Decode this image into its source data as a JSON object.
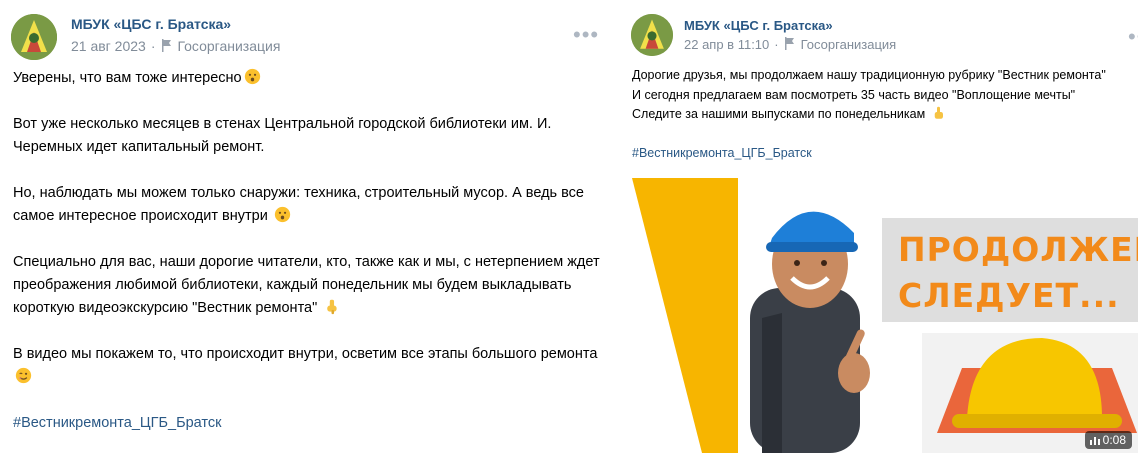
{
  "posts": [
    {
      "author": "МБУК «ЦБС г. Братска»",
      "date": "21 авг 2023",
      "category": "Госорганизация",
      "paragraphs": [
        "Уверены, что вам тоже интересно",
        "Вот уже несколько месяцев в стенах Центральной городской библиотеки им. И. Черемных идет капитальный ремонт.",
        "Но, наблюдать мы можем только снаружи: техника, строительный мусор. А ведь все самое интересное происходит внутри",
        "Специально для вас, наши дорогие читатели, кто, также как и мы, с нетерпением ждет преображения любимой библиотеки, каждый понедельник мы будем выкладывать короткую видеоэкскурсию \"Вестник ремонта\"",
        "В видео мы покажем то, что происходит внутри, осветим все этапы большого ремонта"
      ],
      "hashtag": "#Вестникремонта_ЦГБ_Братск",
      "emojis": [
        "hushed-face-emoji",
        "hushed-face-emoji",
        "pointing-down-emoji",
        "winking-face-emoji"
      ]
    },
    {
      "author": "МБУК «ЦБС г. Братска»",
      "date": "22 апр в 11:10",
      "category": "Госорганизация",
      "lines": [
        "Дорогие друзья, мы продолжаем нашу традиционную рубрику \"Вестник ремонта\"",
        "И сегодня предлагаем вам посмотреть 35 часть видео \"Воплощение мечты\"",
        "Следите за нашими выпусками по понедельникам"
      ],
      "hashtag": "#Вестникремонта_ЦГБ_Братск",
      "video": {
        "banner_line1": "ПРОДОЛЖЕНИЕ",
        "banner_line2": "СЛЕДУЕТ...",
        "duration": "0:08"
      }
    }
  ],
  "colors": {
    "link": "#2a5885",
    "meta": "#818c99",
    "banner_orange": "#f28a1a",
    "triangle_yellow": "#f7b500"
  }
}
